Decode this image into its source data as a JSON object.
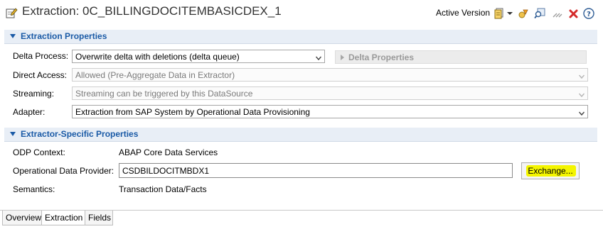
{
  "header": {
    "title": "Extraction: 0C_BILLINGDOCITEMBASICDEX_1",
    "active_version": "Active Version",
    "toolbar_icons": [
      "version-dropdown-icon",
      "chevron-down-icon",
      "activate-icon",
      "where-used-icon",
      "collapse-icon",
      "close-red-icon",
      "help-icon"
    ]
  },
  "extraction_properties": {
    "title": "Extraction Properties",
    "delta_process": {
      "label": "Delta Process:",
      "value": "Overwrite delta with deletions (delta queue)"
    },
    "delta_properties": {
      "label": "Delta Properties"
    },
    "direct_access": {
      "label": "Direct Access:",
      "value": "Allowed (Pre-Aggregate Data in Extractor)"
    },
    "streaming": {
      "label": "Streaming:",
      "value": "Streaming can be triggered by this DataSource"
    },
    "adapter": {
      "label": "Adapter:",
      "value": "Extraction from SAP System by Operational Data Provisioning"
    }
  },
  "extractor_properties": {
    "title": "Extractor-Specific Properties",
    "odp_context": {
      "label": "ODP Context:",
      "value": "ABAP Core Data Services"
    },
    "odp_provider": {
      "label": "Operational Data Provider:",
      "value": "CSDBILDOCITMBDX1",
      "button": "Exchange..."
    },
    "semantics": {
      "label": "Semantics:",
      "value": "Transaction Data/Facts"
    }
  },
  "tabs": [
    {
      "label": "Overview",
      "active": false
    },
    {
      "label": "Extraction",
      "active": true
    },
    {
      "label": "Fields",
      "active": false
    }
  ],
  "colors": {
    "section_header_text": "#1a5aa6",
    "section_header_bg": "#e8eef6",
    "highlight": "#f4f500",
    "close_red": "#d42a2a"
  }
}
